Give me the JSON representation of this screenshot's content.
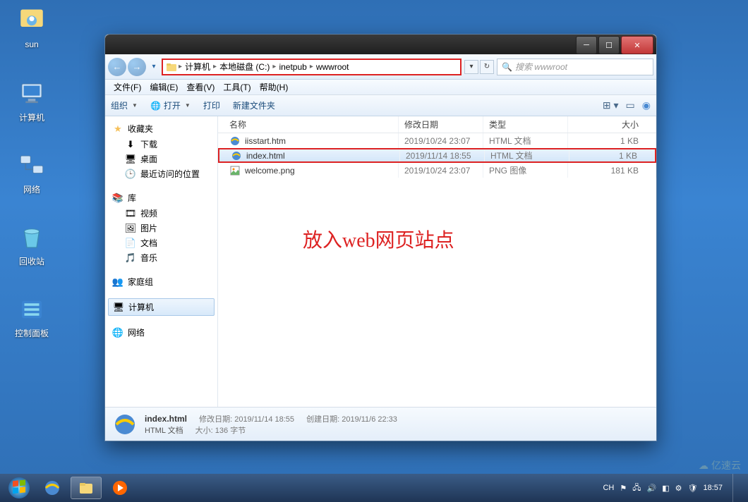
{
  "desktop_icons": [
    {
      "label": "sun",
      "icon": "user"
    },
    {
      "label": "计算机",
      "icon": "computer"
    },
    {
      "label": "网络",
      "icon": "network"
    },
    {
      "label": "回收站",
      "icon": "recycle"
    },
    {
      "label": "控制面板",
      "icon": "control"
    }
  ],
  "window": {
    "breadcrumb": [
      "计算机",
      "本地磁盘 (C:)",
      "inetpub",
      "wwwroot"
    ],
    "search_placeholder": "搜索 wwwroot",
    "menu": [
      "文件(F)",
      "编辑(E)",
      "查看(V)",
      "工具(T)",
      "帮助(H)"
    ],
    "toolbar": {
      "organize": "组织",
      "open": "打开",
      "print": "打印",
      "new_folder": "新建文件夹"
    },
    "sidebar": {
      "favorites": "收藏夹",
      "downloads": "下载",
      "desktop": "桌面",
      "recent": "最近访问的位置",
      "libraries": "库",
      "videos": "视频",
      "pictures": "图片",
      "documents": "文档",
      "music": "音乐",
      "homegroup": "家庭组",
      "computer": "计算机",
      "network": "网络"
    },
    "columns": {
      "name": "名称",
      "date": "修改日期",
      "type": "类型",
      "size": "大小"
    },
    "files": [
      {
        "name": "iisstart.htm",
        "date": "2019/10/24 23:07",
        "type": "HTML 文档",
        "size": "1 KB",
        "icon": "ie"
      },
      {
        "name": "index.html",
        "date": "2019/11/14 18:55",
        "type": "HTML 文档",
        "size": "1 KB",
        "icon": "ie",
        "selected": true
      },
      {
        "name": "welcome.png",
        "date": "2019/10/24 23:07",
        "type": "PNG 图像",
        "size": "181 KB",
        "icon": "png"
      }
    ],
    "annotation": "放入web网页站点",
    "detail": {
      "name": "index.html",
      "type": "HTML 文档",
      "mod_label": "修改日期:",
      "mod": "2019/11/14 18:55",
      "size_label": "大小:",
      "size": "136 字节",
      "created_label": "创建日期:",
      "created": "2019/11/6 22:33"
    }
  },
  "taskbar": {
    "lang": "CH",
    "time": "18:57"
  },
  "watermark": "亿速云"
}
